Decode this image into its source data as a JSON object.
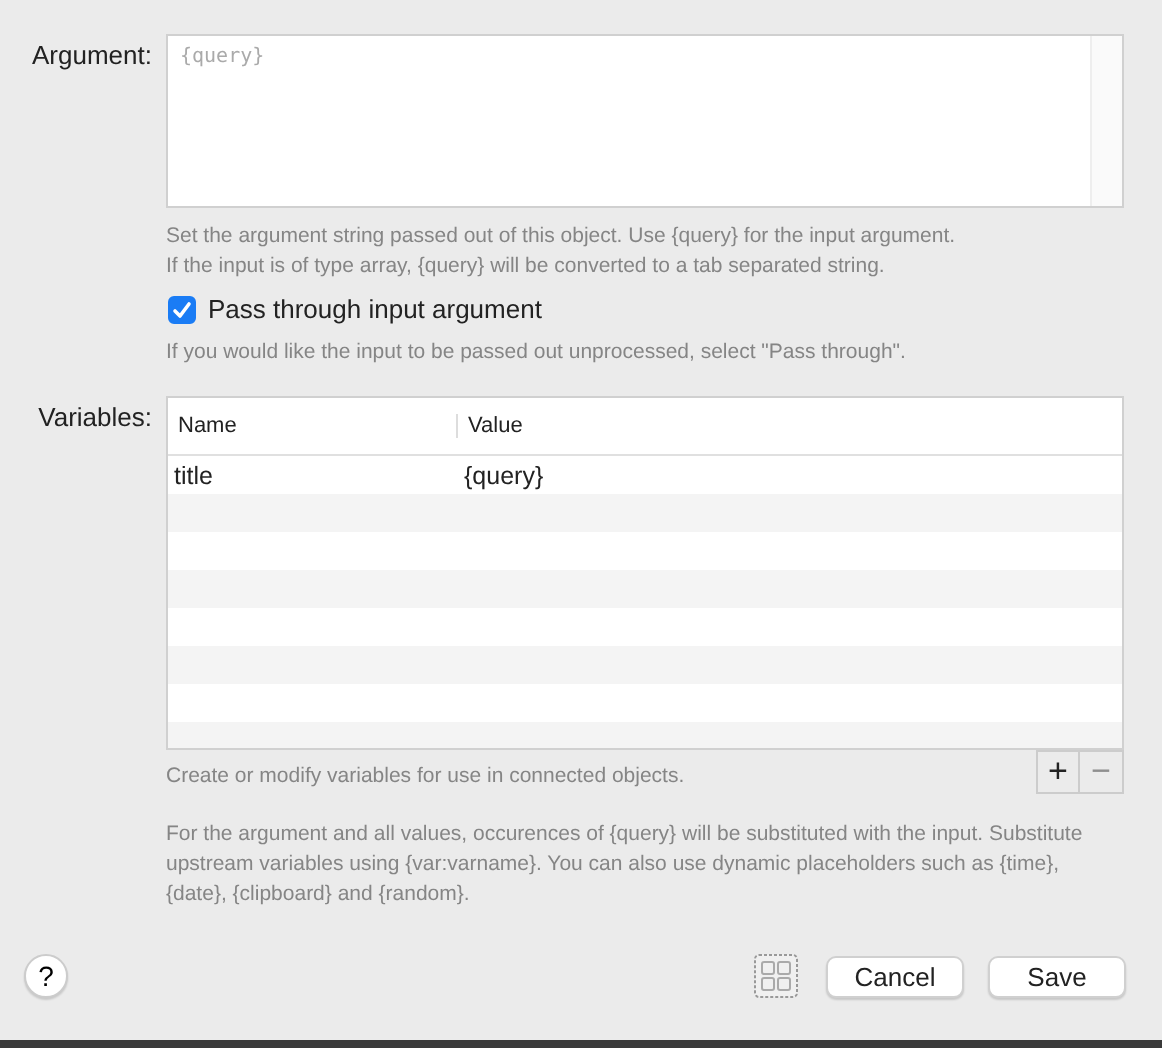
{
  "argument": {
    "label": "Argument:",
    "placeholder": "{query}",
    "help": [
      "Set the argument string passed out of this object. Use {query} for the input argument.",
      "If the input is of type array, {query} will be converted to a tab separated string."
    ]
  },
  "pass_through": {
    "label": "Pass through input argument",
    "checked": true,
    "help": "If you would like the input to be passed out unprocessed, select \"Pass through\"."
  },
  "variables": {
    "label": "Variables:",
    "columns": [
      "Name",
      "Value"
    ],
    "rows": [
      [
        "title",
        "{query}"
      ]
    ],
    "add_button": {
      "label": "+",
      "disabled": false
    },
    "remove_button": {
      "label": "−",
      "disabled": true
    },
    "help": "Create or modify variables for use in connected objects."
  },
  "note": "For the argument and all values, occurences of {query} will be substituted with the input. Substitute upstream variables using {var:varname}. You can also use dynamic placeholders such as {time}, {date}, {clipboard} and {random}.",
  "footer": {
    "help": "?",
    "buttons": [
      "Cancel",
      "Save"
    ]
  }
}
